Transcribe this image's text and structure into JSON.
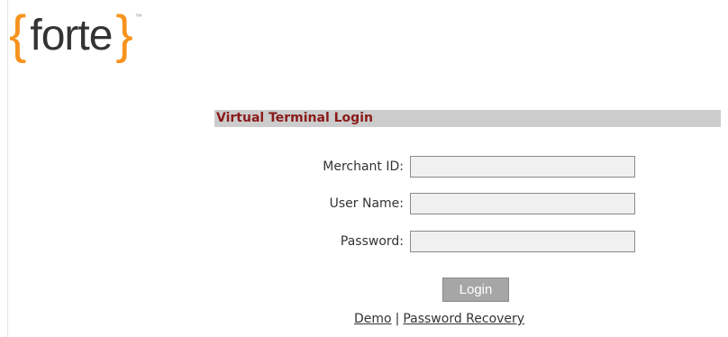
{
  "logo": {
    "open_brace": "{",
    "word": "forte",
    "close_brace": "}",
    "tm": "™",
    "colors": {
      "brace": "#f7931e",
      "word": "#333333"
    }
  },
  "login": {
    "header": "Virtual Terminal Login",
    "fields": [
      {
        "label": "Merchant ID:",
        "value": ""
      },
      {
        "label": "User Name:",
        "value": ""
      },
      {
        "label": "Password:",
        "value": ""
      }
    ],
    "button_label": "Login",
    "links": {
      "demo": "Demo",
      "separator": "|",
      "recovery": "Password Recovery"
    }
  },
  "colors": {
    "header_bg": "#cccccc",
    "header_text": "#8b1a1a",
    "button_bg": "#a6a6a6"
  }
}
